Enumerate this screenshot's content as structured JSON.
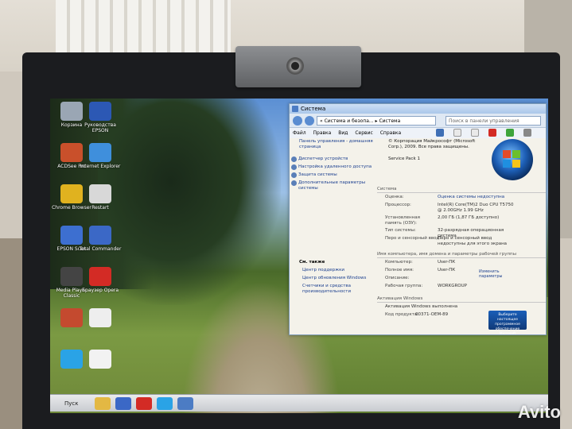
{
  "desktop_icons": [
    {
      "label": "Корзина",
      "icon": "recycle-bin-icon",
      "color": "#9aa6b4"
    },
    {
      "label": "Руководства EPSON",
      "icon": "epson-manuals-icon",
      "color": "#2c58b4"
    },
    {
      "label": "ACDSee Pro",
      "icon": "acdsee-icon",
      "color": "#c9502b"
    },
    {
      "label": "Internet Explorer",
      "icon": "ie-icon",
      "color": "#3f8fdc"
    },
    {
      "label": "Chrome Browser",
      "icon": "chrome-icon",
      "color": "#e0b21f"
    },
    {
      "label": "Restart",
      "icon": "restart-icon",
      "color": "#d8d8d8"
    },
    {
      "label": "EPSON Scan",
      "icon": "scanner-icon",
      "color": "#3d6fd0"
    },
    {
      "label": "Total Commander",
      "icon": "floppy-icon",
      "color": "#3b68c6"
    },
    {
      "label": "Media Player Classic",
      "icon": "media-player-icon",
      "color": "#444"
    },
    {
      "label": "Браузер Opera",
      "icon": "opera-icon",
      "color": "#d32b25"
    },
    {
      "label": "",
      "icon": "folder-icon",
      "color": "#c44a2f"
    },
    {
      "label": "",
      "icon": "document-icon",
      "color": "#eeeeee"
    },
    {
      "label": "",
      "icon": "skype-icon",
      "color": "#2aa3e6"
    },
    {
      "label": "",
      "icon": "blank-file-icon",
      "color": "#f2f2f2"
    }
  ],
  "taskbar": {
    "start_label": "Пуск",
    "items": [
      {
        "icon": "explorer-icon",
        "color": "#e3b843"
      },
      {
        "icon": "floppy-icon",
        "color": "#3b68c6"
      },
      {
        "icon": "opera-icon",
        "color": "#d32b25"
      },
      {
        "icon": "skype-icon",
        "color": "#2aa3e6"
      },
      {
        "icon": "window-icon",
        "color": "#4c7cc4"
      }
    ]
  },
  "window": {
    "title": "Система",
    "address": "« Система и безопа... ▸ Система",
    "search_placeholder": "Поиск в панели управления",
    "menu": [
      "Файл",
      "Правка",
      "Вид",
      "Сервис",
      "Справка"
    ],
    "left_pane": {
      "home": "Панель управления - домашняя страница",
      "tasks": [
        "Диспетчер устройств",
        "Настройка удаленного доступа",
        "Защита системы",
        "Дополнительные параметры системы"
      ],
      "see_also_title": "См. также",
      "see_also": [
        "Центр поддержки",
        "Центр обновления Windows",
        "Счетчики и средства производительности"
      ]
    },
    "right_pane": {
      "copyright": "© Корпорация Майкрософт (Microsoft Corp.), 2009. Все права защищены.",
      "service_pack": "Service Pack 1",
      "system_heading": "Система",
      "system_rows": [
        {
          "k": "Оценка:",
          "v": "Оценка системы недоступна"
        },
        {
          "k": "Процессор:",
          "v": "Intel(R) Core(TM)2 Duo CPU T5750 @ 2.00GHz 1.99 GHz"
        },
        {
          "k": "Установленная память (ОЗУ):",
          "v": "2,00 ГБ (1,87 ГБ доступно)"
        },
        {
          "k": "Тип системы:",
          "v": "32-разрядная операционная система"
        },
        {
          "k": "Перо и сенсорный ввод:",
          "v": "Перо и сенсорный ввод недоступны для этого экрана"
        }
      ],
      "computer_heading": "Имя компьютера, имя домена и параметры рабочей группы",
      "computer_rows": [
        {
          "k": "Компьютер:",
          "v": "User-ПК"
        },
        {
          "k": "Полное имя:",
          "v": "User-ПК"
        },
        {
          "k": "Описание:",
          "v": ""
        },
        {
          "k": "Рабочая группа:",
          "v": "WORKGROUP"
        }
      ],
      "change_settings": "Изменить параметры",
      "activation_heading": "Активация Windows",
      "activation_rows": [
        {
          "k": "",
          "v": "Активация Windows выполнена"
        },
        {
          "k": "Код продукта:",
          "v": "00371-OEM-89"
        }
      ],
      "genuine_badge": "Выберите настоящее программное обеспечение Microsoft"
    }
  },
  "watermark": "Avito"
}
